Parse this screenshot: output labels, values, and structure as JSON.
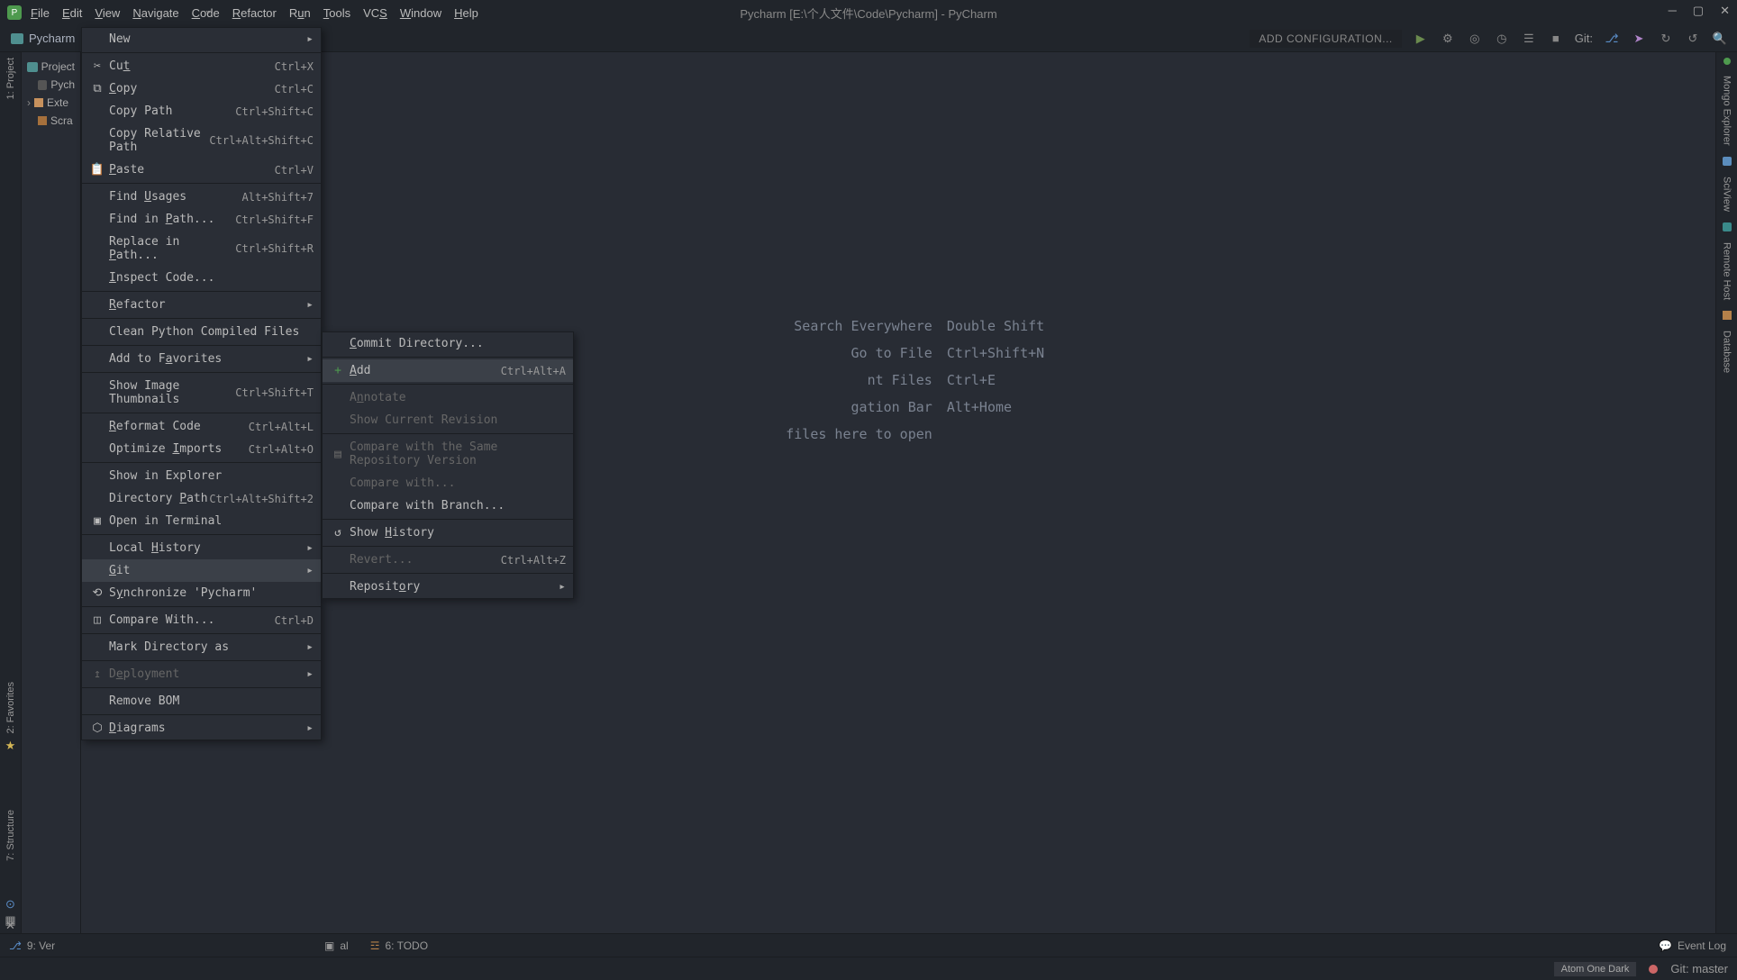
{
  "title": "Pycharm [E:\\个人文件\\Code\\Pycharm] - PyCharm",
  "menubar": [
    "File",
    "Edit",
    "View",
    "Navigate",
    "Code",
    "Refactor",
    "Run",
    "Tools",
    "VCS",
    "Window",
    "Help"
  ],
  "project_label": "Pycharm",
  "add_config": "ADD CONFIGURATION...",
  "git_label": "Git:",
  "tree": {
    "project": "Project",
    "pycharm": "Pych",
    "external": "Exte",
    "scratches": "Scra"
  },
  "shortcuts": [
    {
      "label": "Search Everywhere",
      "key": "Double Shift"
    },
    {
      "label": "Go to File",
      "key": "Ctrl+Shift+N"
    },
    {
      "label": "nt Files",
      "key": "Ctrl+E"
    },
    {
      "label": "gation Bar",
      "key": "Alt+Home"
    },
    {
      "label": "files here to open",
      "key": ""
    }
  ],
  "left_gutter": {
    "project": "1: Project",
    "favorites": "2: Favorites",
    "structure": "7: Structure"
  },
  "right_gutter": {
    "mongo": "Mongo Explorer",
    "sciview": "SciView",
    "remote": "Remote Host",
    "database": "Database"
  },
  "context_menu": [
    {
      "icon": "",
      "label": "New",
      "shortcut": "",
      "arrow": true
    },
    {
      "sep": true
    },
    {
      "icon": "✂",
      "label": "Cut",
      "shortcut": "Ctrl+X",
      "u": 2
    },
    {
      "icon": "⧉",
      "label": "Copy",
      "shortcut": "Ctrl+C",
      "u": 0
    },
    {
      "icon": "",
      "label": "Copy Path",
      "shortcut": "Ctrl+Shift+C"
    },
    {
      "icon": "",
      "label": "Copy Relative Path",
      "shortcut": "Ctrl+Alt+Shift+C"
    },
    {
      "icon": "📋",
      "label": "Paste",
      "shortcut": "Ctrl+V",
      "u": 0
    },
    {
      "sep": true
    },
    {
      "icon": "",
      "label": "Find Usages",
      "shortcut": "Alt+Shift+7",
      "u": 5
    },
    {
      "icon": "",
      "label": "Find in Path...",
      "shortcut": "Ctrl+Shift+F",
      "u": 8
    },
    {
      "icon": "",
      "label": "Replace in Path...",
      "shortcut": "Ctrl+Shift+R",
      "u": 11
    },
    {
      "icon": "",
      "label": "Inspect Code...",
      "shortcut": "",
      "u": 0
    },
    {
      "sep": true
    },
    {
      "icon": "",
      "label": "Refactor",
      "shortcut": "",
      "arrow": true,
      "u": 0
    },
    {
      "sep": true
    },
    {
      "icon": "",
      "label": "Clean Python Compiled Files",
      "shortcut": ""
    },
    {
      "sep": true
    },
    {
      "icon": "",
      "label": "Add to Favorites",
      "shortcut": "",
      "arrow": true,
      "u": 8
    },
    {
      "sep": true
    },
    {
      "icon": "",
      "label": "Show Image Thumbnails",
      "shortcut": "Ctrl+Shift+T"
    },
    {
      "sep": true
    },
    {
      "icon": "",
      "label": "Reformat Code",
      "shortcut": "Ctrl+Alt+L",
      "u": 0
    },
    {
      "icon": "",
      "label": "Optimize Imports",
      "shortcut": "Ctrl+Alt+O",
      "u": 9
    },
    {
      "sep": true
    },
    {
      "icon": "",
      "label": "Show in Explorer",
      "shortcut": ""
    },
    {
      "icon": "",
      "label": "Directory Path",
      "shortcut": "Ctrl+Alt+Shift+2",
      "u": 10
    },
    {
      "icon": "▣",
      "label": "Open in Terminal",
      "shortcut": ""
    },
    {
      "sep": true
    },
    {
      "icon": "",
      "label": "Local History",
      "shortcut": "",
      "arrow": true,
      "u": 6
    },
    {
      "icon": "",
      "label": "Git",
      "shortcut": "",
      "arrow": true,
      "hover": true,
      "u": 0
    },
    {
      "icon": "⟲",
      "label": "Synchronize 'Pycharm'",
      "shortcut": "",
      "u": 1
    },
    {
      "sep": true
    },
    {
      "icon": "◫",
      "label": "Compare With...",
      "shortcut": "Ctrl+D"
    },
    {
      "sep": true
    },
    {
      "icon": "",
      "label": "Mark Directory as",
      "shortcut": "",
      "arrow": true
    },
    {
      "sep": true
    },
    {
      "icon": "↥",
      "label": "Deployment",
      "shortcut": "",
      "arrow": true,
      "disabled": true,
      "u": 1
    },
    {
      "sep": true
    },
    {
      "icon": "",
      "label": "Remove BOM",
      "shortcut": ""
    },
    {
      "sep": true
    },
    {
      "icon": "⬡",
      "label": "Diagrams",
      "shortcut": "",
      "arrow": true,
      "u": 0
    }
  ],
  "submenu": [
    {
      "icon": "",
      "label": "Commit Directory...",
      "shortcut": "",
      "u": 0
    },
    {
      "sep": true
    },
    {
      "icon": "+",
      "label": "Add",
      "shortcut": "Ctrl+Alt+A",
      "hover": true,
      "u": 0,
      "iconcolor": "#4e9a4e"
    },
    {
      "sep": true
    },
    {
      "icon": "",
      "label": "Annotate",
      "shortcut": "",
      "disabled": true,
      "u": 1
    },
    {
      "icon": "",
      "label": "Show Current Revision",
      "shortcut": "",
      "disabled": true
    },
    {
      "sep": true
    },
    {
      "icon": "▤",
      "label": "Compare with the Same Repository Version",
      "shortcut": "",
      "disabled": true
    },
    {
      "icon": "",
      "label": "Compare with...",
      "shortcut": "",
      "disabled": true
    },
    {
      "icon": "",
      "label": "Compare with Branch...",
      "shortcut": ""
    },
    {
      "sep": true
    },
    {
      "icon": "↺",
      "label": "Show History",
      "shortcut": "",
      "u": 5
    },
    {
      "sep": true
    },
    {
      "icon": "",
      "label": "Revert...",
      "shortcut": "Ctrl+Alt+Z",
      "disabled": true
    },
    {
      "sep": true
    },
    {
      "icon": "",
      "label": "Repository",
      "shortcut": "",
      "arrow": true,
      "u": 7
    }
  ],
  "status_tabs": {
    "version": "9: Ver",
    "terminal": "al",
    "todo": "6: TODO",
    "eventlog": "Event Log"
  },
  "statusbar": {
    "theme": "Atom One Dark",
    "git": "Git: master"
  }
}
